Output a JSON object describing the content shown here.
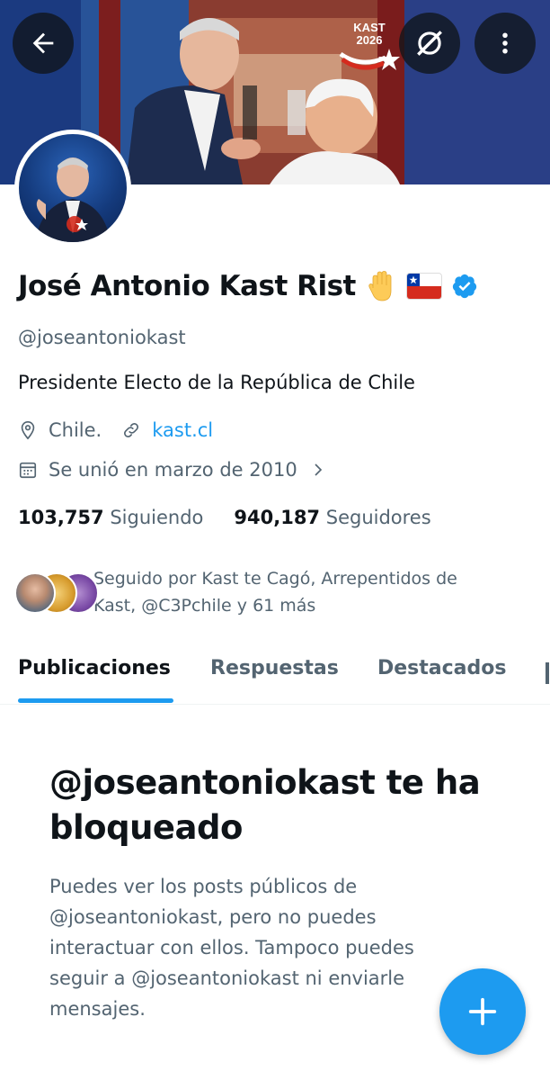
{
  "banner": {
    "logo_line1": "KAST",
    "logo_line2": "2026"
  },
  "icons": {
    "back": "arrow-left-icon",
    "grok": "grok-icon",
    "more": "more-vertical-icon",
    "location": "location-pin-icon",
    "link": "link-icon",
    "calendar": "calendar-icon",
    "chevron": "chevron-right-icon",
    "verified": "verified-badge-icon",
    "compose": "plus-icon"
  },
  "profile": {
    "display_name": "José Antonio Kast Rist",
    "handle": "@joseantoniokast",
    "bio": "Presidente Electo de la República de Chile",
    "location": "Chile.",
    "website": "kast.cl",
    "joined": "Se unió en marzo de 2010",
    "following_count": "103,757",
    "following_label": "Siguiendo",
    "followers_count": "940,187",
    "followers_label": "Seguidores",
    "followed_by": "Seguido por Kast te Cagó, Arrepentidos de Kast, @C3Pchile y 61 más"
  },
  "tabs": [
    {
      "label": "Publicaciones",
      "active": true
    },
    {
      "label": "Respuestas",
      "active": false
    },
    {
      "label": "Destacados",
      "active": false
    }
  ],
  "blocked": {
    "title": "@joseantoniokast te ha bloqueado",
    "body": "Puedes ver los posts públicos de @joseantoniokast, pero no puedes interactuar con ellos. Tampoco puedes seguir a @joseantoniokast ni enviarle mensajes."
  },
  "colors": {
    "accent": "#1d9bf0",
    "text_primary": "#0f1419",
    "text_secondary": "#536471"
  }
}
